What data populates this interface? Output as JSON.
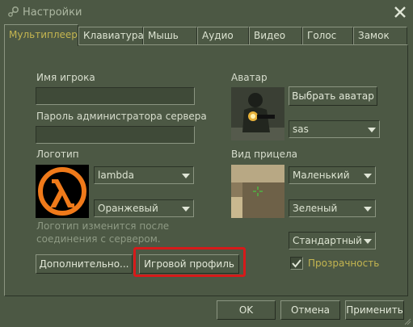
{
  "window": {
    "title": "Настройки"
  },
  "tabs": [
    {
      "label": "Мультиплеер"
    },
    {
      "label": "Клавиатура"
    },
    {
      "label": "Мышь"
    },
    {
      "label": "Аудио"
    },
    {
      "label": "Видео"
    },
    {
      "label": "Голос"
    },
    {
      "label": "Замок"
    }
  ],
  "player": {
    "name_label": "Имя игрока",
    "name_value": "",
    "admin_password_label": "Пароль администратора сервера",
    "admin_password_value": ""
  },
  "logo": {
    "label": "Логотип",
    "image_select": "lambda",
    "color_select": "Оранжевый",
    "hint": "Логотип изменится после соединения с сервером."
  },
  "avatar": {
    "label": "Аватар",
    "choose_button": "Выбрать аватар",
    "model_select": "sas"
  },
  "crosshair": {
    "label": "Вид прицела",
    "size_select": "Маленький",
    "color_select": "Зеленый",
    "style_select": "Стандартный",
    "transparency_label": "Прозрачность",
    "transparency_checked": true
  },
  "buttons": {
    "advanced": "Дополнительно...",
    "game_profile": "Игровой профиль",
    "ok": "OK",
    "cancel": "Отмена",
    "apply": "Применить"
  },
  "colors": {
    "background": "#4c5844",
    "accent_text": "#c4b550",
    "highlight_border": "#d61a1a",
    "logo_orange": "#f07a1a"
  }
}
